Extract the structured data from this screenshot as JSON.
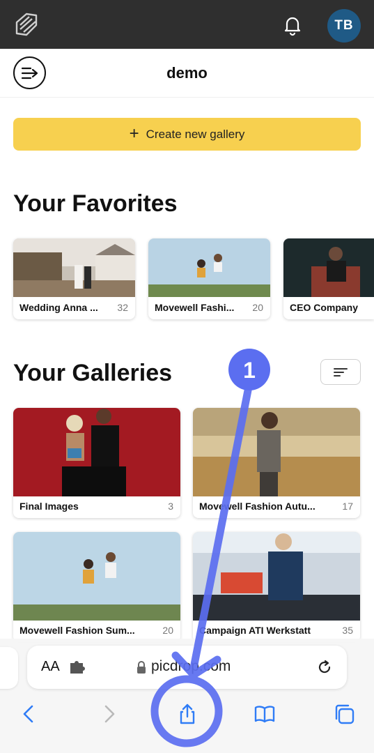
{
  "header": {
    "avatar_initials": "TB"
  },
  "subheader": {
    "title": "demo"
  },
  "create_button": {
    "label": "Create new gallery"
  },
  "favorites": {
    "title": "Your Favorites",
    "items": [
      {
        "label": "Wedding Anna ...",
        "count": "32"
      },
      {
        "label": "Movewell Fashi...",
        "count": "20"
      },
      {
        "label": "CEO Company",
        "count": ""
      }
    ]
  },
  "galleries": {
    "title": "Your Galleries",
    "items": [
      {
        "label": "Final Images",
        "count": "3"
      },
      {
        "label": "Movewell Fashion Autu...",
        "count": "17"
      },
      {
        "label": "Movewell Fashion Sum...",
        "count": "20"
      },
      {
        "label": "Campaign ATI Werkstatt",
        "count": "35"
      }
    ]
  },
  "browser": {
    "aa_label": "AA",
    "url": "picdrop.com"
  },
  "annotation": {
    "step_number": "1"
  },
  "colors": {
    "topbar": "#2f2f2f",
    "accent_yellow": "#f7d04f",
    "avatar": "#1f5a86",
    "annotation_blue": "#5b6ef0",
    "ios_blue": "#2f7cf6"
  }
}
